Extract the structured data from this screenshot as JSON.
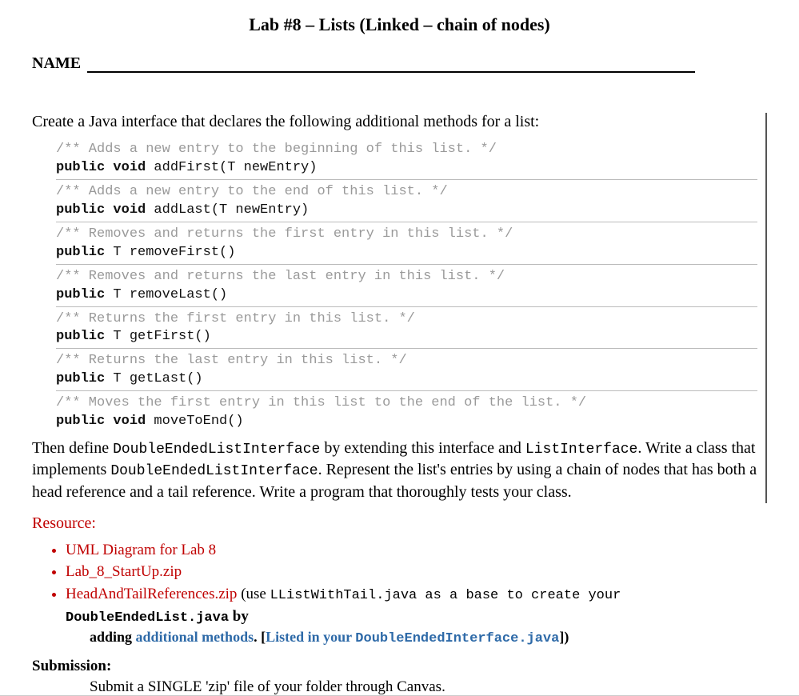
{
  "title": "Lab #8 – Lists (Linked – chain of nodes)",
  "name_label": "NAME",
  "intro": "Create a Java interface that declares the following additional methods for a list:",
  "methods": [
    {
      "comment": "/** Adds a new entry to the beginning of this list. */",
      "sig_kw": "public void",
      "sig_rest": " addFirst(T newEntry)"
    },
    {
      "comment": "/** Adds a new entry to the end of this list. */",
      "sig_kw": "public void",
      "sig_rest": " addLast(T newEntry)"
    },
    {
      "comment": "/** Removes and returns the first entry in this list. */",
      "sig_kw": "public",
      "sig_rest": " T removeFirst()"
    },
    {
      "comment": "/** Removes and returns the last entry in this list. */",
      "sig_kw": "public",
      "sig_rest": " T removeLast()"
    },
    {
      "comment": "/** Returns the first entry in this list. */",
      "sig_kw": "public",
      "sig_rest": " T getFirst()"
    },
    {
      "comment": "/** Returns the last entry in this list. */",
      "sig_kw": "public",
      "sig_rest": " T getLast()"
    },
    {
      "comment": "/** Moves the first entry in this list to the end of the list. */",
      "sig_kw": "public void",
      "sig_rest": " moveToEnd()"
    }
  ],
  "then": {
    "p1a": "Then define ",
    "code1": "DoubleEndedListInterface",
    "p1b": " by extending this interface and ",
    "code2": "ListInterface",
    "p1c": ". Write a class that implements ",
    "code3": "DoubleEndedListInterface",
    "p1d": ". Represent the list's entries by using a chain of nodes that has both a head reference and a tail reference. Write a program that thoroughly tests your class."
  },
  "resource": {
    "header": "Resource:",
    "items": {
      "uml": "UML Diagram for Lab 8",
      "startup": "Lab_8_StartUp.zip",
      "headtail": "HeadAndTailReferences.zip",
      "paren_a": " (use ",
      "file1": "LListWithTail.java",
      "paren_b": " as a base to create your ",
      "file2": "DoubleEndedList.java",
      "paren_c": " by",
      "cont_a": "adding ",
      "add_methods": "additional methods",
      "cont_b": ". [",
      "listed": "Listed in your ",
      "file3": "DoubleEndedInterface.java",
      "cont_c": "])"
    }
  },
  "submission": {
    "header": "Submission:",
    "body": "Submit a SINGLE 'zip' file of your folder through Canvas."
  }
}
